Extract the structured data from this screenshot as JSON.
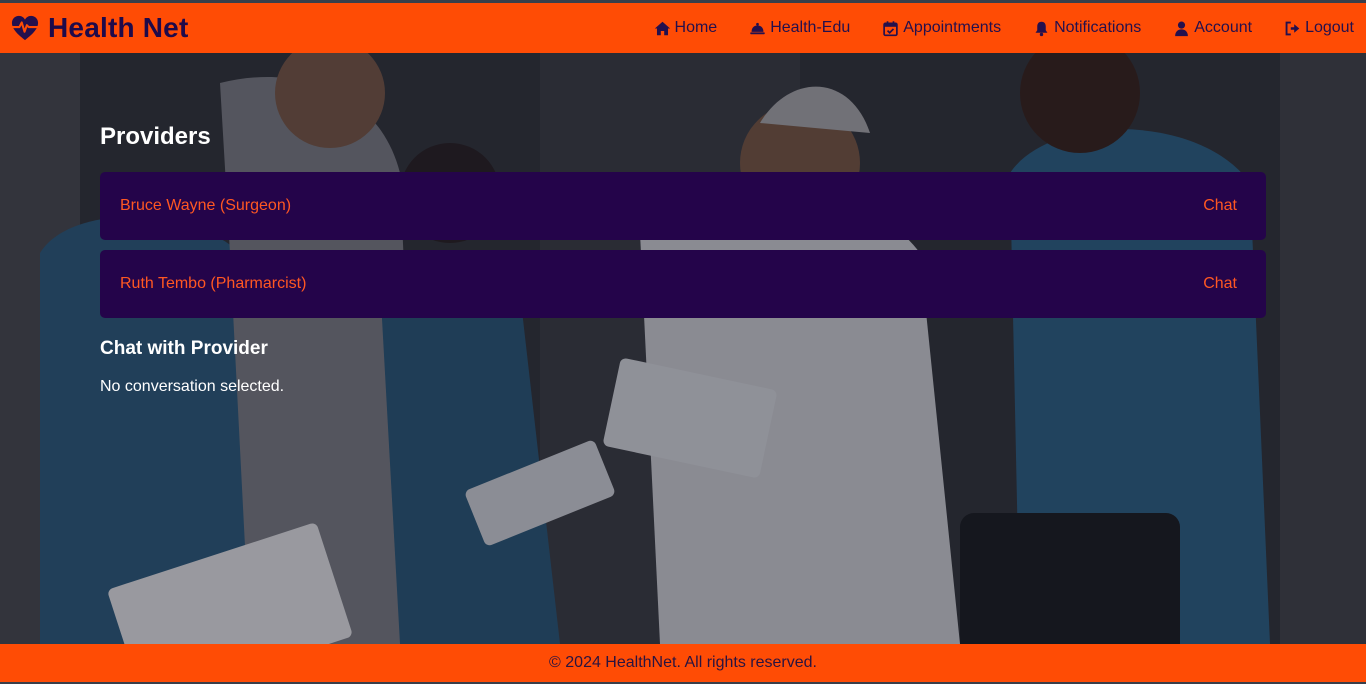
{
  "colors": {
    "header_bg": "#ff4c05",
    "brand_text": "#1f0a4a",
    "card_bg": "#24044a",
    "card_text": "#ff5722"
  },
  "header": {
    "brand_icon": "heartbeat-icon",
    "brand_title": "Health Net",
    "nav": [
      {
        "icon": "home-icon",
        "label": "Home"
      },
      {
        "icon": "bell-concierge-icon",
        "label": "Health-Edu"
      },
      {
        "icon": "calendar-check-icon",
        "label": "Appointments"
      },
      {
        "icon": "bell-icon",
        "label": "Notifications"
      },
      {
        "icon": "user-icon",
        "label": "Account"
      },
      {
        "icon": "logout-icon",
        "label": "Logout"
      }
    ]
  },
  "main": {
    "providers_title": "Providers",
    "providers": [
      {
        "name": "Bruce Wayne (Surgeon)",
        "action": "Chat"
      },
      {
        "name": "Ruth Tembo (Pharmarcist)",
        "action": "Chat"
      }
    ],
    "chat_title": "Chat with Provider",
    "chat_empty": "No conversation selected."
  },
  "footer": {
    "text": "© 2024 HealthNet. All rights reserved."
  }
}
